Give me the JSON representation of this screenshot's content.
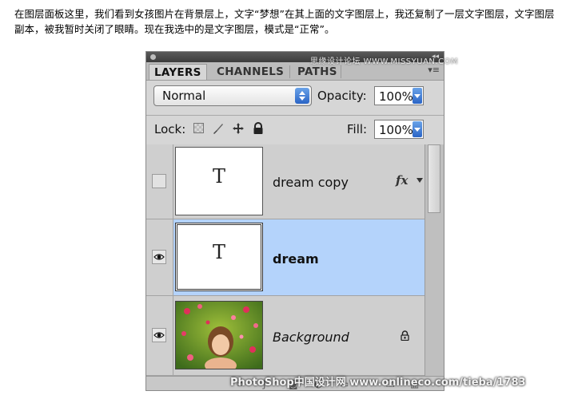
{
  "caption": "在图层面板这里，我们看到女孩图片在背景层上，文字“梦想”在其上面的文字图层上，我还复制了一层文字图层，文字图层副本，被我暂时关闭了眼睛。现在我选中的是文字图层，模式是“正常”。",
  "watermark_top": "思缘设计论坛 WWW.MISSYUAN.COM",
  "watermark_bottom": "PhotoShop中国设计网 www.onlineco.com/tieba/1783",
  "panel": {
    "collapse_glyph": "◂◂",
    "menu_glyph": "▾≡",
    "tabs": [
      {
        "label": "LAYERS",
        "active": true
      },
      {
        "label": "CHANNELS",
        "active": false
      },
      {
        "label": "PATHS",
        "active": false
      }
    ],
    "blend_mode": "Normal",
    "opacity_label": "Opacity:",
    "opacity_value": "100%",
    "lock_label": "Lock:",
    "fill_label": "Fill:",
    "fill_value": "100%",
    "layers": [
      {
        "name": "dream copy",
        "visible": false,
        "selected": false,
        "type": "text",
        "thumb_glyph": "T",
        "fx": "fx"
      },
      {
        "name": "dream",
        "visible": true,
        "selected": true,
        "type": "text",
        "thumb_glyph": "T"
      },
      {
        "name": "Background",
        "visible": true,
        "selected": false,
        "type": "image",
        "locked": true
      }
    ]
  },
  "colors": {
    "selected_row": "#b4d3fb",
    "stepper_blue": "#2a64c6"
  }
}
